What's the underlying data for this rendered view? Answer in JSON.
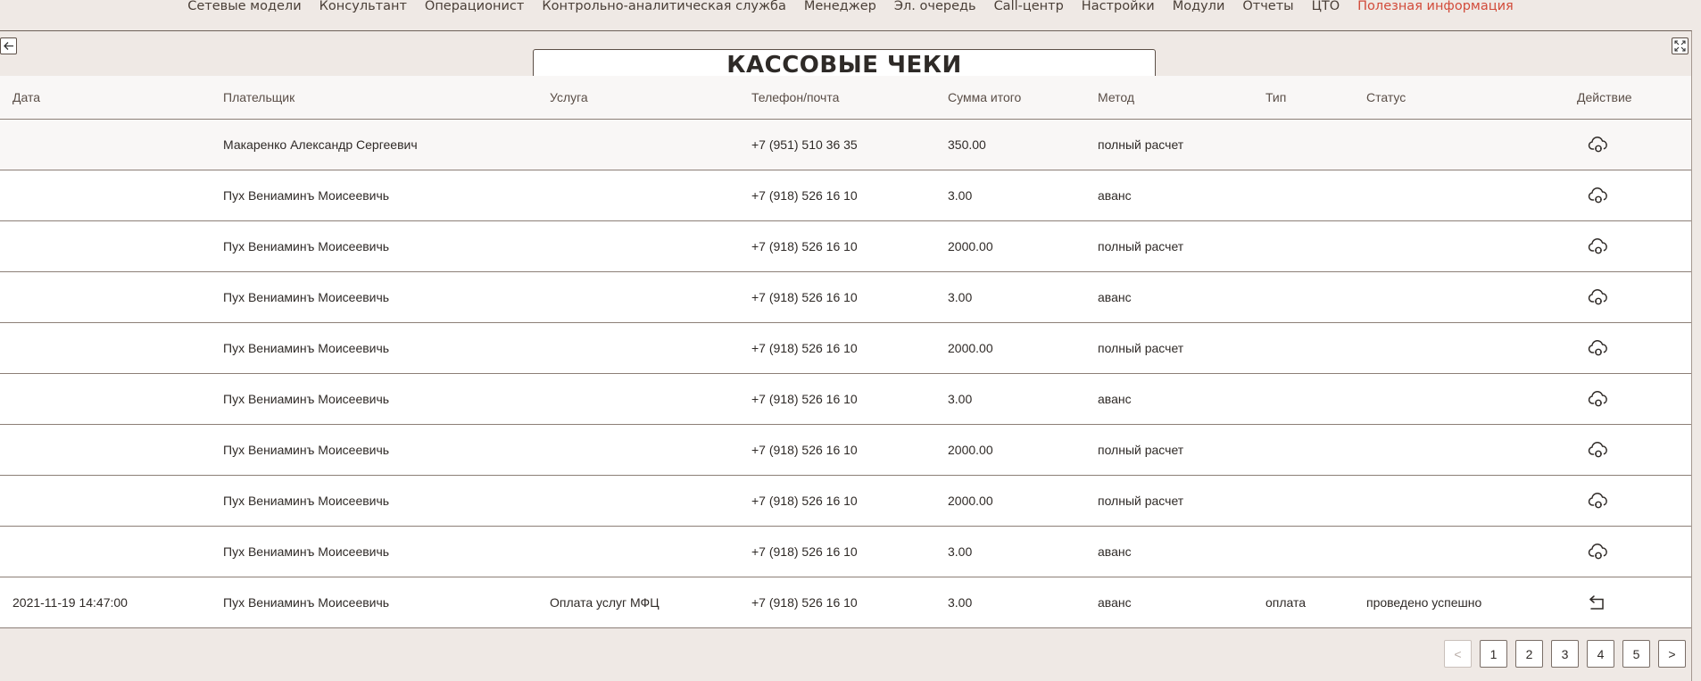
{
  "nav": [
    "Сетевые модели",
    "Консультант",
    "Операционист",
    "Контрольно-аналитическая служба",
    "Менеджер",
    "Эл. очередь",
    "Call-центр",
    "Настройки",
    "Модули",
    "Отчеты",
    "ЦТО",
    "Полезная информация"
  ],
  "page_title": "КАССОВЫЕ ЧЕКИ",
  "columns": [
    "Дата",
    "Плательщик",
    "Услуга",
    "Телефон/почта",
    "Сумма итого",
    "Метод",
    "Тип",
    "Статус",
    "Действие"
  ],
  "rows": [
    {
      "date": "",
      "payer": "Макаренко Александр Сергеевич",
      "service": "",
      "phone": "+7 (951) 510 36 35",
      "sum": "350.00",
      "method": "полный расчет",
      "type": "",
      "status": "",
      "action": "cloud-sync-icon"
    },
    {
      "date": "",
      "payer": "Пух Вениаминъ Моисеевичь",
      "service": "",
      "phone": "+7 (918) 526 16 10",
      "sum": "3.00",
      "method": "аванс",
      "type": "",
      "status": "",
      "action": "cloud-sync-icon"
    },
    {
      "date": "",
      "payer": "Пух Вениаминъ Моисеевичь",
      "service": "",
      "phone": "+7 (918) 526 16 10",
      "sum": "2000.00",
      "method": "полный расчет",
      "type": "",
      "status": "",
      "action": "cloud-sync-icon"
    },
    {
      "date": "",
      "payer": "Пух Вениаминъ Моисеевичь",
      "service": "",
      "phone": "+7 (918) 526 16 10",
      "sum": "3.00",
      "method": "аванс",
      "type": "",
      "status": "",
      "action": "cloud-sync-icon"
    },
    {
      "date": "",
      "payer": "Пух Вениаминъ Моисеевичь",
      "service": "",
      "phone": "+7 (918) 526 16 10",
      "sum": "2000.00",
      "method": "полный расчет",
      "type": "",
      "status": "",
      "action": "cloud-sync-icon"
    },
    {
      "date": "",
      "payer": "Пух Вениаминъ Моисеевичь",
      "service": "",
      "phone": "+7 (918) 526 16 10",
      "sum": "3.00",
      "method": "аванс",
      "type": "",
      "status": "",
      "action": "cloud-sync-icon"
    },
    {
      "date": "",
      "payer": "Пух Вениаминъ Моисеевичь",
      "service": "",
      "phone": "+7 (918) 526 16 10",
      "sum": "2000.00",
      "method": "полный расчет",
      "type": "",
      "status": "",
      "action": "cloud-sync-icon"
    },
    {
      "date": "",
      "payer": "Пух Вениаминъ Моисеевичь",
      "service": "",
      "phone": "+7 (918) 526 16 10",
      "sum": "2000.00",
      "method": "полный расчет",
      "type": "",
      "status": "",
      "action": "cloud-sync-icon"
    },
    {
      "date": "",
      "payer": "Пух Вениаминъ Моисеевичь",
      "service": "",
      "phone": "+7 (918) 526 16 10",
      "sum": "3.00",
      "method": "аванс",
      "type": "",
      "status": "",
      "action": "cloud-sync-icon"
    },
    {
      "date": "2021-11-19 14:47:00",
      "payer": "Пух Вениаминъ Моисеевичь",
      "service": "Оплата услуг МФЦ",
      "phone": "+7 (918) 526 16 10",
      "sum": "3.00",
      "method": "аванс",
      "type": "оплата",
      "status": "проведено успешно",
      "action": "return-icon"
    }
  ],
  "pagination": {
    "prev": "<",
    "pages": [
      "1",
      "2",
      "3",
      "4",
      "5"
    ],
    "next": ">"
  },
  "colors": {
    "accent": "#d24b3a",
    "nav_text": "#4a3f37",
    "background": "#efe9e5"
  }
}
